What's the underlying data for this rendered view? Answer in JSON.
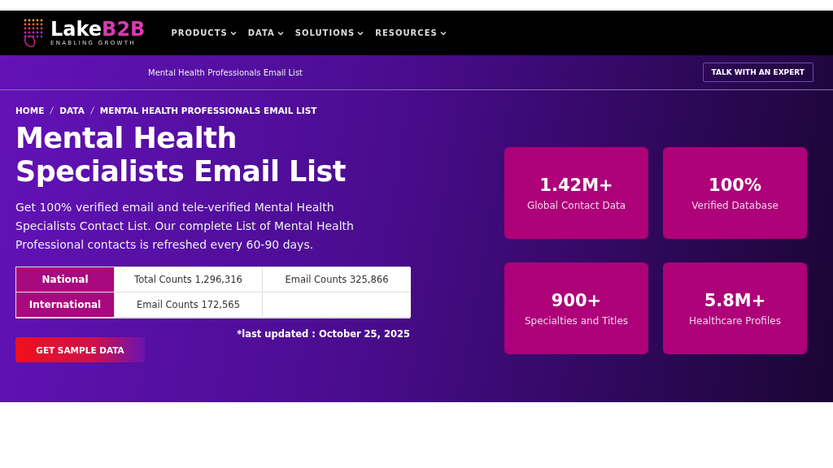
{
  "logo": {
    "name": "Lake",
    "accent": "B2B",
    "tagline": "ENABLING GROWTH"
  },
  "nav": [
    {
      "label": "PRODUCTS",
      "dropdown": true
    },
    {
      "label": "DATA",
      "dropdown": true
    },
    {
      "label": "SOLUTIONS",
      "dropdown": true
    },
    {
      "label": "RESOURCES",
      "dropdown": true
    }
  ],
  "subbar": {
    "title": "Mental Health Professionals Email List",
    "button": "TALK WITH AN EXPERT"
  },
  "breadcrumb": [
    "HOME",
    "DATA",
    "MENTAL HEALTH PROFESSIONALS EMAIL LIST"
  ],
  "heading": [
    "Mental Health",
    "Specialists Email List"
  ],
  "description": "Get 100% verified email and tele-verified Mental Health Specialists Contact List. Our complete List of Mental Health Professional contacts is refreshed every 60-90 days.",
  "counts_table": [
    {
      "label": "National",
      "cells": [
        "Total Counts 1,296,316",
        "Email Counts 325,866"
      ]
    },
    {
      "label": "International",
      "cells": [
        "Email Counts 172,565"
      ]
    }
  ],
  "last_updated": "*last updated : October 25, 2025",
  "sample_button": "GET SAMPLE DATA",
  "stats": [
    {
      "value": "1.42M+",
      "label": "Global Contact Data"
    },
    {
      "value": "100%",
      "label": "Verified Database"
    },
    {
      "value": "900+",
      "label": "Specialties and Titles"
    },
    {
      "value": "5.8M+",
      "label": "Healthcare Profiles"
    }
  ]
}
